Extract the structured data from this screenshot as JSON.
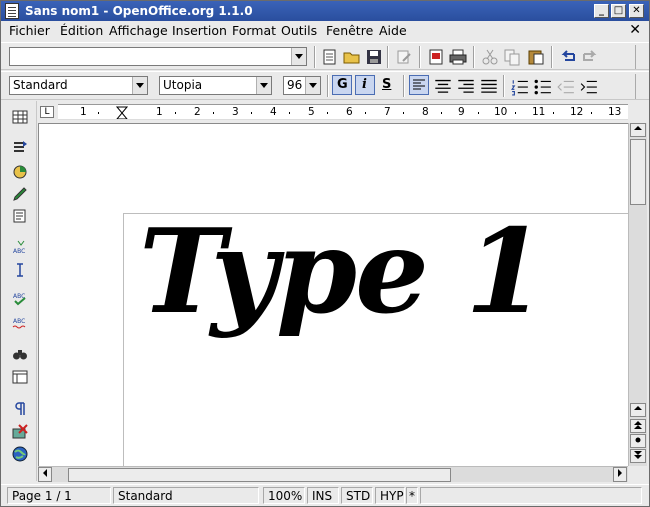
{
  "window": {
    "title": "Sans nom1 - OpenOffice.org 1.1.0",
    "minimize_glyph": "_",
    "maximize_glyph": "□",
    "close_glyph": "✕"
  },
  "menubar": {
    "items": [
      "Fichier",
      "Édition",
      "Affichage",
      "Insertion",
      "Format",
      "Outils",
      "Fenêtre",
      "Aide"
    ],
    "close_glyph": "✕"
  },
  "toolbar": {
    "url_value": "",
    "paragraph_style": "Standard",
    "font_name": "Utopia",
    "font_size": "96",
    "bold_label": "G",
    "italic_label": "i",
    "shadow_label": "S"
  },
  "ruler": {
    "tab_glyph": "L",
    "numbers": [
      "1",
      "2",
      "3",
      "4",
      "5",
      "6",
      "7",
      "8",
      "9",
      "10",
      "11",
      "12",
      "13"
    ]
  },
  "document": {
    "text": "Type 1"
  },
  "statusbar": {
    "page": "Page 1 / 1",
    "style": "Standard",
    "zoom": "100%",
    "insert_mode": "INS",
    "selection_mode": "STD",
    "hyperlink_mode": "HYP",
    "modified": "*"
  }
}
